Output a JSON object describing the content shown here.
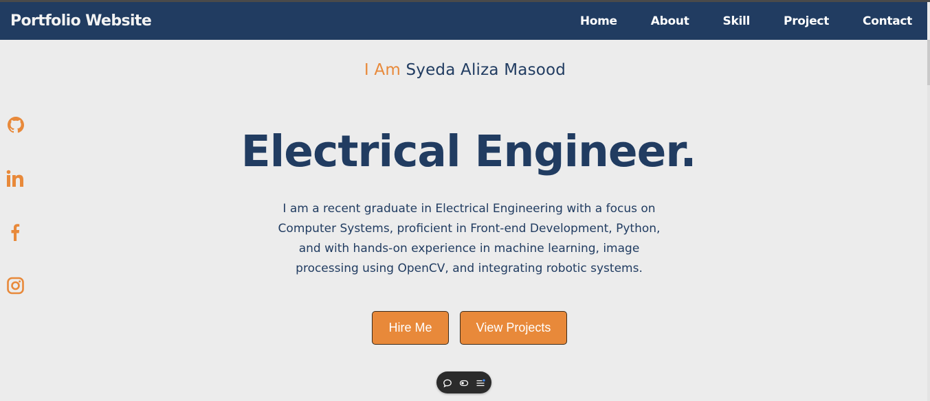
{
  "navbar": {
    "brand": "Portfolio Website",
    "links": [
      "Home",
      "About",
      "Skill",
      "Project",
      "Contact"
    ]
  },
  "socials": [
    {
      "icon": "github-icon"
    },
    {
      "icon": "linkedin-icon"
    },
    {
      "icon": "facebook-icon"
    },
    {
      "icon": "instagram-icon"
    }
  ],
  "hero": {
    "intro_prefix": "I Am",
    "name": "Syeda Aliza Masood",
    "title": "Electrical Engineer.",
    "description": "I am a recent graduate in Electrical Engineering with a focus on Computer Systems, proficient in Front-end Development, Python, and with hands-on experience in machine learning, image processing using OpenCV, and integrating robotic systems.",
    "buttons": {
      "hire": "Hire Me",
      "projects": "View Projects"
    }
  },
  "toolbar": {
    "icons": [
      "comment-icon",
      "toggle-icon",
      "menu-icon"
    ]
  },
  "colors": {
    "navy": "#213c61",
    "accent": "#e8893a",
    "background": "#ececec"
  }
}
